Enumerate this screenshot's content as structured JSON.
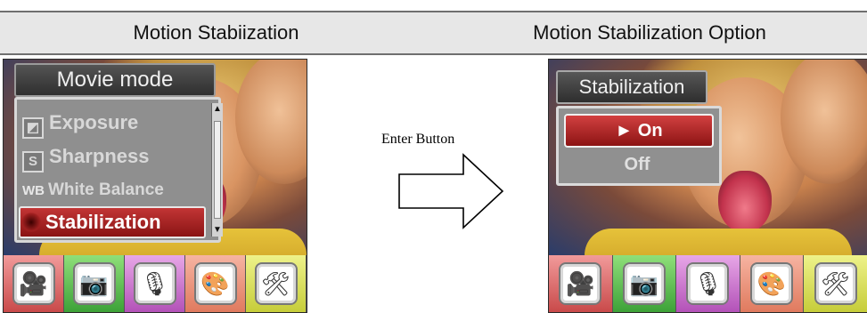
{
  "headers": {
    "left": "Motion Stabiization",
    "right": "Motion Stabilization Option"
  },
  "left_screen": {
    "title": "Movie mode",
    "items": [
      {
        "label": "Exposure",
        "icon": "exposure-icon",
        "selected": false
      },
      {
        "label": "Sharpness",
        "icon_text": "S",
        "selected": false
      },
      {
        "label": "White Balance",
        "icon_text": "WB",
        "selected": false
      },
      {
        "label": "Stabilization",
        "icon": "stabilization-icon",
        "selected": true
      }
    ],
    "scroll": {
      "up": "▲",
      "down": "▼"
    }
  },
  "middle": {
    "label": "Enter Button"
  },
  "right_screen": {
    "title": "Stabilization",
    "options": [
      {
        "label": "► On",
        "selected": true
      },
      {
        "label": "Off",
        "selected": false
      }
    ]
  },
  "tabs": [
    {
      "name": "tab-video",
      "icon": "video-camera-icon",
      "glyph": "🎥",
      "color": "#d35a5a"
    },
    {
      "name": "tab-camera",
      "icon": "camera-icon",
      "glyph": "📷",
      "color": "#4aa540"
    },
    {
      "name": "tab-audio",
      "icon": "microphone-icon",
      "glyph": "🎙",
      "color": "#b859bd"
    },
    {
      "name": "tab-effects",
      "icon": "palette-icon",
      "glyph": "🎨",
      "color": "#e38365"
    },
    {
      "name": "tab-setup",
      "icon": "tools-icon",
      "glyph": "🛠",
      "color": "#cbd03f"
    }
  ]
}
